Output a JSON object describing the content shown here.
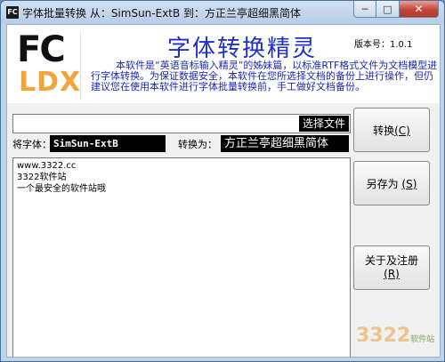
{
  "titlebar": {
    "app_icon_text": "FC",
    "title": "字体批量转换 从：SimSun-ExtB  到：方正兰亭超细黑简体",
    "minimize": "─",
    "maximize": "□",
    "close": "✕"
  },
  "header": {
    "logo_top": "FC",
    "logo_bottom": "LDX",
    "app_name": "字体转换精灵",
    "version": "版本号：1.0.1",
    "description": "本软件是“英语音标输入精灵”的姊妹篇，以标准RTF格式文件为文档模型进行字体转换。为保证数据安全，本软件在您所选择文档的备份上进行操作，但仍建议您在使用本软件进行字体批量转换前，手工做好文档备份。"
  },
  "file": {
    "path_value": "",
    "select_button": "选择文件"
  },
  "fonts": {
    "from_label": "将字体：",
    "from_value": "SimSun-ExtB",
    "to_label": "转换为：",
    "to_value": "方正兰亭超细黑简体"
  },
  "content": {
    "lines": [
      "www.3322.cc",
      "3322软件站",
      "一个最安全的软件站哦"
    ]
  },
  "buttons": {
    "convert": "转换",
    "convert_key": "(C)",
    "save_as": "另存为",
    "save_as_key": "(S)",
    "about": "关于及注册",
    "about_key": "(R)"
  },
  "watermark": {
    "logo": "3322",
    "text": "软件站"
  }
}
